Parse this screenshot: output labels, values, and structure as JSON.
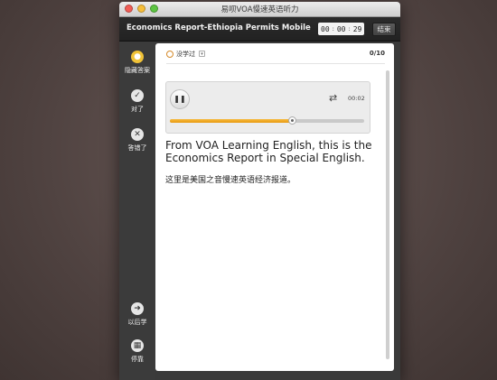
{
  "window": {
    "title": "易呗VOA慢速英语听力"
  },
  "header": {
    "title": "Economics Report-Ethiopia Permits Mobile Banking and Mo",
    "timer": {
      "hours": "00",
      "minutes": "00",
      "seconds": "29"
    },
    "end_label": "结束"
  },
  "sidebar": {
    "items": [
      {
        "label": "隐藏答案",
        "icon": "lightbulb-icon"
      },
      {
        "label": "对了",
        "icon": "check-icon"
      },
      {
        "label": "答错了",
        "icon": "x-icon"
      },
      {
        "label": "以后学",
        "icon": "forward-arrow-icon"
      },
      {
        "label": "停靠",
        "icon": "grid-icon"
      }
    ]
  },
  "status": {
    "label": "没学过",
    "count": "0/10"
  },
  "player": {
    "time": "00:02",
    "progress_fraction": 0.63
  },
  "sentence": {
    "english": "From VOA Learning English, this is the Economics Report in Special English.",
    "chinese": "这里是美国之音慢速英语经济报道。"
  },
  "colors": {
    "accent": "#f0a11d",
    "bulb": "#f0c237"
  }
}
